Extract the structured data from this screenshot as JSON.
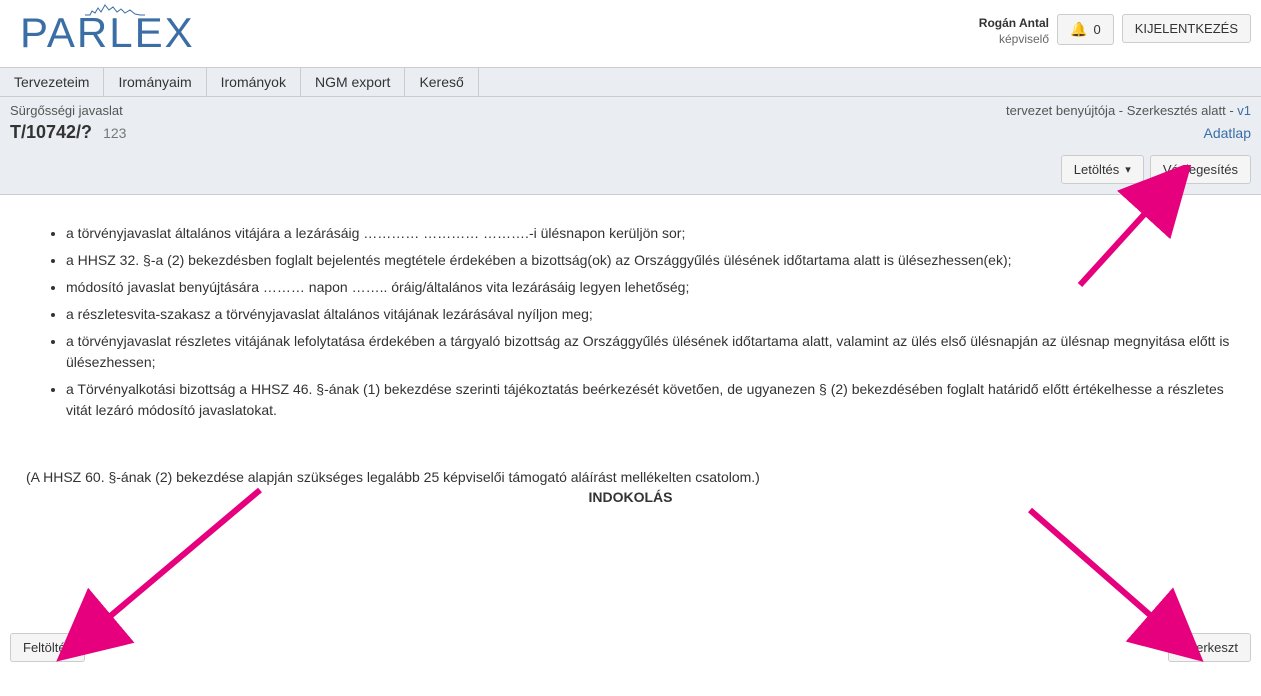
{
  "header": {
    "logo_text": "PARLEX",
    "user_name": "Rogán Antal",
    "user_role": "képviselő",
    "notifications_count": "0",
    "logout_label": "KIJELENTKEZÉS"
  },
  "nav": {
    "items": [
      "Tervezeteim",
      "Irományaim",
      "Irományok",
      "NGM export",
      "Kereső"
    ]
  },
  "subheader": {
    "left_label": "Sürgősségi javaslat",
    "right_status": "tervezet benyújtója - Szerkesztés alatt - ",
    "version": "v1",
    "doc_id": "T/10742/?",
    "doc_suffix": "123",
    "adatlap_label": "Adatlap",
    "download_label": "Letöltés",
    "finalize_label": "Véglegesítés"
  },
  "content": {
    "bullets": [
      "a törvényjavaslat általános vitájára a lezárásáig ………… ………… ……….-i ülésnapon kerüljön sor;",
      "a HHSZ 32. §-a (2) bekezdésben foglalt bejelentés megtétele érdekében a bizottság(ok) az Országgyűlés ülésének időtartama alatt is ülésezhessen(ek);",
      "módosító javaslat benyújtására ……… napon …….. óráig/általános vita lezárásáig legyen lehetőség;",
      "a részletesvita-szakasz a törvényjavaslat általános vitájának lezárásával nyíljon meg;",
      "a törvényjavaslat részletes vitájának lefolytatása érdekében a tárgyaló bizottság az Országgyűlés ülésének időtartama alatt, valamint az ülés első ülésnapján az ülésnap megnyitása előtt is ülésezhessen;",
      "a Törvényalkotási bizottság a HHSZ 46. §-ának (1) bekezdése szerinti tájékoztatás beérkezését követően, de ugyanezen § (2) bekezdésében foglalt határidő előtt értékelhesse a részletes vitát lezáró módosító javaslatokat."
    ],
    "note": "(A HHSZ 60. §-ának (2) bekezdése alapján szükséges legalább 25 képviselői támogató aláírást mellékelten csatolom.)",
    "section_title": "INDOKOLÁS"
  },
  "footer": {
    "upload_label": "Feltöltés",
    "edit_label": "Szerkeszt"
  }
}
